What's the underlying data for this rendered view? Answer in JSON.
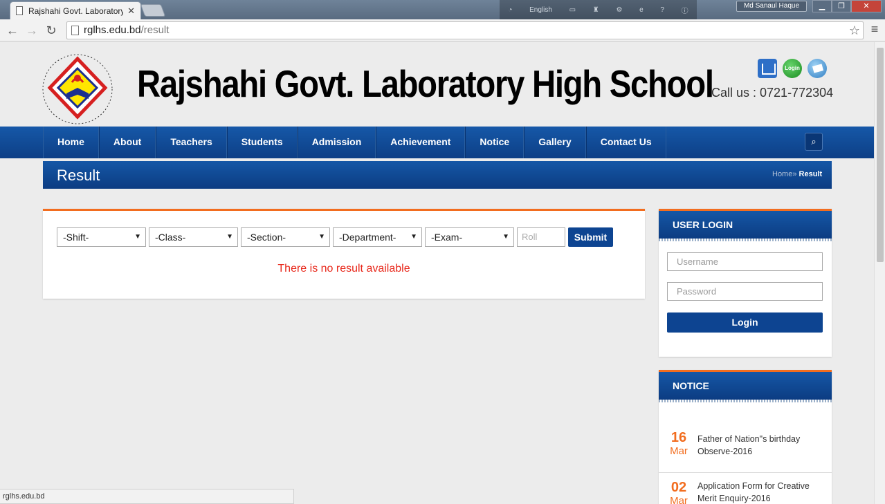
{
  "browser": {
    "tab_title": "Rajshahi Govt. Laboratory",
    "language": "English",
    "user_name": "Md Sanaul Haque",
    "url_domain": "rglhs.edu.bd",
    "url_path": "/result",
    "status_url": "rglhs.edu.bd",
    "window_buttons": {
      "minimize": "▁",
      "restore": "❐",
      "close": "✕"
    }
  },
  "header": {
    "site_name": "Rajshahi Govt. Laboratory High School",
    "login_icon_label": "Login",
    "call_us": "Call us : 0721-772304"
  },
  "nav": {
    "items": [
      "Home",
      "About",
      "Teachers",
      "Students",
      "Admission",
      "Achievement",
      "Notice",
      "Gallery",
      "Contact Us"
    ]
  },
  "page": {
    "title": "Result",
    "breadcrumb": {
      "home": "Home",
      "separator": "»",
      "current": "Result"
    }
  },
  "filters": {
    "shift": "-Shift-",
    "class": "-Class-",
    "section": "-Section-",
    "department": "-Department-",
    "exam": "-Exam-",
    "roll_placeholder": "Roll",
    "submit_label": "Submit"
  },
  "result_message": "There is no result available",
  "user_login": {
    "heading": "USER LOGIN",
    "username_placeholder": "Username",
    "password_placeholder": "Password",
    "login_label": "Login"
  },
  "notice": {
    "heading": "NOTICE",
    "items": [
      {
        "day": "16",
        "month": "Mar",
        "text": "Father of Nation\"s birthday Observe-2016"
      },
      {
        "day": "02",
        "month": "Mar",
        "text": "Application Form for Creative Merit Enquiry-2016"
      }
    ]
  },
  "colors": {
    "primary_blue": "#0d4491",
    "accent_orange": "#f26d1f",
    "error_red": "#e8281b"
  }
}
